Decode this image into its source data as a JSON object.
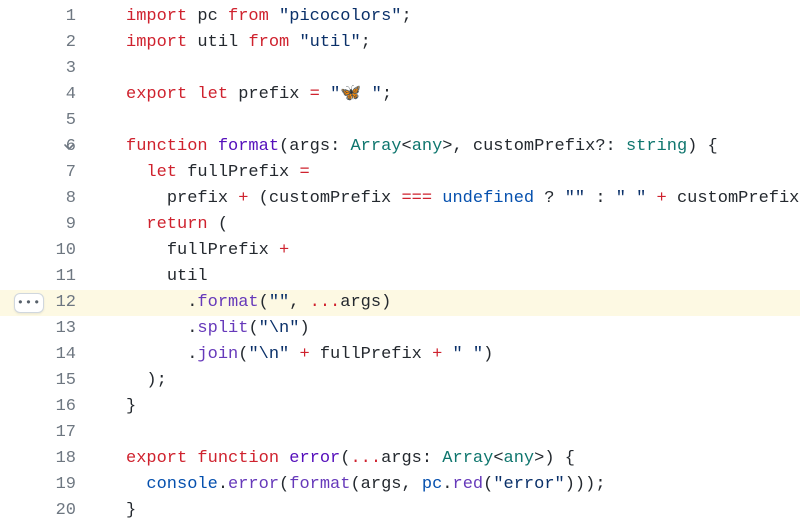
{
  "gutter": {
    "more_icon_title": "More actions",
    "fold_icon_title": "Collapse"
  },
  "lines": [
    {
      "num": 1,
      "fold": false,
      "hl": false,
      "more": false,
      "tokens": [
        {
          "c": "kw",
          "t": "import"
        },
        {
          "c": "op",
          "t": " "
        },
        {
          "c": "id",
          "t": "pc"
        },
        {
          "c": "op",
          "t": " "
        },
        {
          "c": "kw",
          "t": "from"
        },
        {
          "c": "op",
          "t": " "
        },
        {
          "c": "str",
          "t": "\"picocolors\""
        },
        {
          "c": "op",
          "t": ";"
        }
      ]
    },
    {
      "num": 2,
      "fold": false,
      "hl": false,
      "more": false,
      "tokens": [
        {
          "c": "kw",
          "t": "import"
        },
        {
          "c": "op",
          "t": " "
        },
        {
          "c": "id",
          "t": "util"
        },
        {
          "c": "op",
          "t": " "
        },
        {
          "c": "kw",
          "t": "from"
        },
        {
          "c": "op",
          "t": " "
        },
        {
          "c": "str",
          "t": "\"util\""
        },
        {
          "c": "op",
          "t": ";"
        }
      ]
    },
    {
      "num": 3,
      "fold": false,
      "hl": false,
      "more": false,
      "tokens": []
    },
    {
      "num": 4,
      "fold": false,
      "hl": false,
      "more": false,
      "tokens": [
        {
          "c": "kw",
          "t": "export"
        },
        {
          "c": "op",
          "t": " "
        },
        {
          "c": "kw",
          "t": "let"
        },
        {
          "c": "op",
          "t": " "
        },
        {
          "c": "id",
          "t": "prefix"
        },
        {
          "c": "op",
          "t": " "
        },
        {
          "c": "opb",
          "t": "="
        },
        {
          "c": "op",
          "t": " "
        },
        {
          "c": "str",
          "t": "\""
        },
        {
          "c": "emoji",
          "t": "🦋"
        },
        {
          "c": "str",
          "t": " \""
        },
        {
          "c": "op",
          "t": ";"
        }
      ]
    },
    {
      "num": 5,
      "fold": false,
      "hl": false,
      "more": false,
      "tokens": []
    },
    {
      "num": 6,
      "fold": true,
      "hl": false,
      "more": false,
      "tokens": [
        {
          "c": "kw",
          "t": "function"
        },
        {
          "c": "op",
          "t": " "
        },
        {
          "c": "fn",
          "t": "format"
        },
        {
          "c": "op",
          "t": "("
        },
        {
          "c": "id",
          "t": "args"
        },
        {
          "c": "op",
          "t": ": "
        },
        {
          "c": "type",
          "t": "Array"
        },
        {
          "c": "op",
          "t": "<"
        },
        {
          "c": "type",
          "t": "any"
        },
        {
          "c": "op",
          "t": ">, "
        },
        {
          "c": "id",
          "t": "customPrefix"
        },
        {
          "c": "op",
          "t": "?: "
        },
        {
          "c": "type",
          "t": "string"
        },
        {
          "c": "op",
          "t": ") {"
        }
      ]
    },
    {
      "num": 7,
      "fold": false,
      "hl": false,
      "more": false,
      "tokens": [
        {
          "c": "op",
          "t": "  "
        },
        {
          "c": "kw",
          "t": "let"
        },
        {
          "c": "op",
          "t": " "
        },
        {
          "c": "id",
          "t": "fullPrefix"
        },
        {
          "c": "op",
          "t": " "
        },
        {
          "c": "opb",
          "t": "="
        }
      ]
    },
    {
      "num": 8,
      "fold": false,
      "hl": false,
      "more": false,
      "tokens": [
        {
          "c": "op",
          "t": "    "
        },
        {
          "c": "id",
          "t": "prefix"
        },
        {
          "c": "op",
          "t": " "
        },
        {
          "c": "opb",
          "t": "+"
        },
        {
          "c": "op",
          "t": " ("
        },
        {
          "c": "id",
          "t": "customPrefix"
        },
        {
          "c": "op",
          "t": " "
        },
        {
          "c": "opb",
          "t": "==="
        },
        {
          "c": "op",
          "t": " "
        },
        {
          "c": "num",
          "t": "undefined"
        },
        {
          "c": "op",
          "t": " ? "
        },
        {
          "c": "str",
          "t": "\"\""
        },
        {
          "c": "op",
          "t": " : "
        },
        {
          "c": "str",
          "t": "\" \""
        },
        {
          "c": "op",
          "t": " "
        },
        {
          "c": "opb",
          "t": "+"
        },
        {
          "c": "op",
          "t": " "
        },
        {
          "c": "id",
          "t": "customPrefix"
        },
        {
          "c": "op",
          "t": ");"
        }
      ]
    },
    {
      "num": 9,
      "fold": false,
      "hl": false,
      "more": false,
      "tokens": [
        {
          "c": "op",
          "t": "  "
        },
        {
          "c": "kw",
          "t": "return"
        },
        {
          "c": "op",
          "t": " ("
        }
      ]
    },
    {
      "num": 10,
      "fold": false,
      "hl": false,
      "more": false,
      "tokens": [
        {
          "c": "op",
          "t": "    "
        },
        {
          "c": "id",
          "t": "fullPrefix"
        },
        {
          "c": "op",
          "t": " "
        },
        {
          "c": "opb",
          "t": "+"
        }
      ]
    },
    {
      "num": 11,
      "fold": false,
      "hl": false,
      "more": false,
      "tokens": [
        {
          "c": "op",
          "t": "    "
        },
        {
          "c": "id",
          "t": "util"
        }
      ]
    },
    {
      "num": 12,
      "fold": false,
      "hl": true,
      "more": true,
      "tokens": [
        {
          "c": "op",
          "t": "      ."
        },
        {
          "c": "call",
          "t": "format"
        },
        {
          "c": "op",
          "t": "("
        },
        {
          "c": "str",
          "t": "\"\""
        },
        {
          "c": "op",
          "t": ", "
        },
        {
          "c": "opb",
          "t": "..."
        },
        {
          "c": "id",
          "t": "args"
        },
        {
          "c": "op",
          "t": ")"
        }
      ]
    },
    {
      "num": 13,
      "fold": false,
      "hl": false,
      "more": false,
      "tokens": [
        {
          "c": "op",
          "t": "      ."
        },
        {
          "c": "call",
          "t": "split"
        },
        {
          "c": "op",
          "t": "("
        },
        {
          "c": "str",
          "t": "\"\\n\""
        },
        {
          "c": "op",
          "t": ")"
        }
      ]
    },
    {
      "num": 14,
      "fold": false,
      "hl": false,
      "more": false,
      "tokens": [
        {
          "c": "op",
          "t": "      ."
        },
        {
          "c": "call",
          "t": "join"
        },
        {
          "c": "op",
          "t": "("
        },
        {
          "c": "str",
          "t": "\"\\n\""
        },
        {
          "c": "op",
          "t": " "
        },
        {
          "c": "opb",
          "t": "+"
        },
        {
          "c": "op",
          "t": " "
        },
        {
          "c": "id",
          "t": "fullPrefix"
        },
        {
          "c": "op",
          "t": " "
        },
        {
          "c": "opb",
          "t": "+"
        },
        {
          "c": "op",
          "t": " "
        },
        {
          "c": "str",
          "t": "\" \""
        },
        {
          "c": "op",
          "t": ")"
        }
      ]
    },
    {
      "num": 15,
      "fold": false,
      "hl": false,
      "more": false,
      "tokens": [
        {
          "c": "op",
          "t": "  );"
        }
      ]
    },
    {
      "num": 16,
      "fold": false,
      "hl": false,
      "more": false,
      "tokens": [
        {
          "c": "op",
          "t": "}"
        }
      ]
    },
    {
      "num": 17,
      "fold": false,
      "hl": false,
      "more": false,
      "tokens": []
    },
    {
      "num": 18,
      "fold": false,
      "hl": false,
      "more": false,
      "tokens": [
        {
          "c": "kw",
          "t": "export"
        },
        {
          "c": "op",
          "t": " "
        },
        {
          "c": "kw",
          "t": "function"
        },
        {
          "c": "op",
          "t": " "
        },
        {
          "c": "fn",
          "t": "error"
        },
        {
          "c": "op",
          "t": "("
        },
        {
          "c": "opb",
          "t": "..."
        },
        {
          "c": "id",
          "t": "args"
        },
        {
          "c": "op",
          "t": ": "
        },
        {
          "c": "type",
          "t": "Array"
        },
        {
          "c": "op",
          "t": "<"
        },
        {
          "c": "type",
          "t": "any"
        },
        {
          "c": "op",
          "t": ">) {"
        }
      ]
    },
    {
      "num": 19,
      "fold": false,
      "hl": false,
      "more": false,
      "tokens": [
        {
          "c": "op",
          "t": "  "
        },
        {
          "c": "prop",
          "t": "console"
        },
        {
          "c": "op",
          "t": "."
        },
        {
          "c": "call",
          "t": "error"
        },
        {
          "c": "op",
          "t": "("
        },
        {
          "c": "call",
          "t": "format"
        },
        {
          "c": "op",
          "t": "("
        },
        {
          "c": "id",
          "t": "args"
        },
        {
          "c": "op",
          "t": ", "
        },
        {
          "c": "prop",
          "t": "pc"
        },
        {
          "c": "op",
          "t": "."
        },
        {
          "c": "call",
          "t": "red"
        },
        {
          "c": "op",
          "t": "("
        },
        {
          "c": "str",
          "t": "\"error\""
        },
        {
          "c": "op",
          "t": ")));"
        }
      ]
    },
    {
      "num": 20,
      "fold": false,
      "hl": false,
      "more": false,
      "tokens": [
        {
          "c": "op",
          "t": "}"
        }
      ]
    }
  ]
}
